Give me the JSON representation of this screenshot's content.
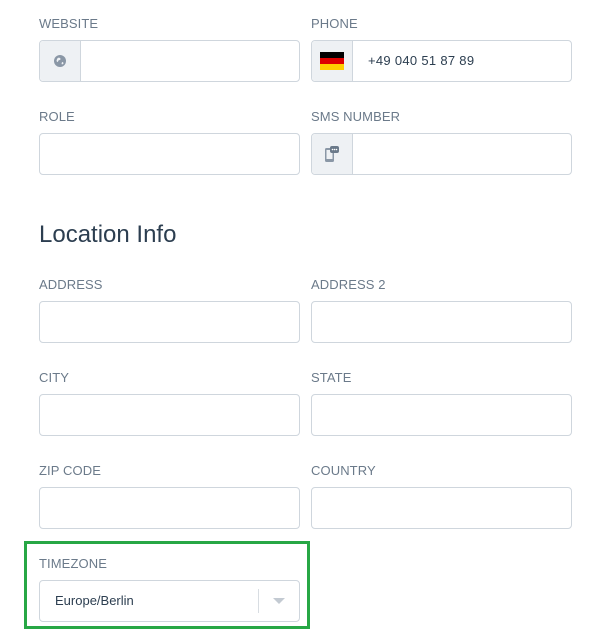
{
  "contact": {
    "website": {
      "label": "WEBSITE",
      "value": "",
      "icon": "globe-icon"
    },
    "phone": {
      "label": "PHONE",
      "value": "+49 040 51 87 89",
      "flag": "germany-flag-icon"
    },
    "role": {
      "label": "ROLE",
      "value": ""
    },
    "sms": {
      "label": "SMS NUMBER",
      "value": "",
      "icon": "sms-phone-icon"
    }
  },
  "location": {
    "title": "Location Info",
    "address": {
      "label": "ADDRESS",
      "value": ""
    },
    "address2": {
      "label": "ADDRESS 2",
      "value": ""
    },
    "city": {
      "label": "CITY",
      "value": ""
    },
    "state": {
      "label": "STATE",
      "value": ""
    },
    "zip": {
      "label": "ZIP CODE",
      "value": ""
    },
    "country": {
      "label": "COUNTRY",
      "value": ""
    },
    "timezone": {
      "label": "TIMEZONE",
      "value": "Europe/Berlin"
    }
  },
  "colors": {
    "highlight": "#27a745",
    "border": "#cfd6dd",
    "addon_bg": "#eef1f4",
    "label": "#6b7a8a",
    "text": "#2c3e50"
  }
}
